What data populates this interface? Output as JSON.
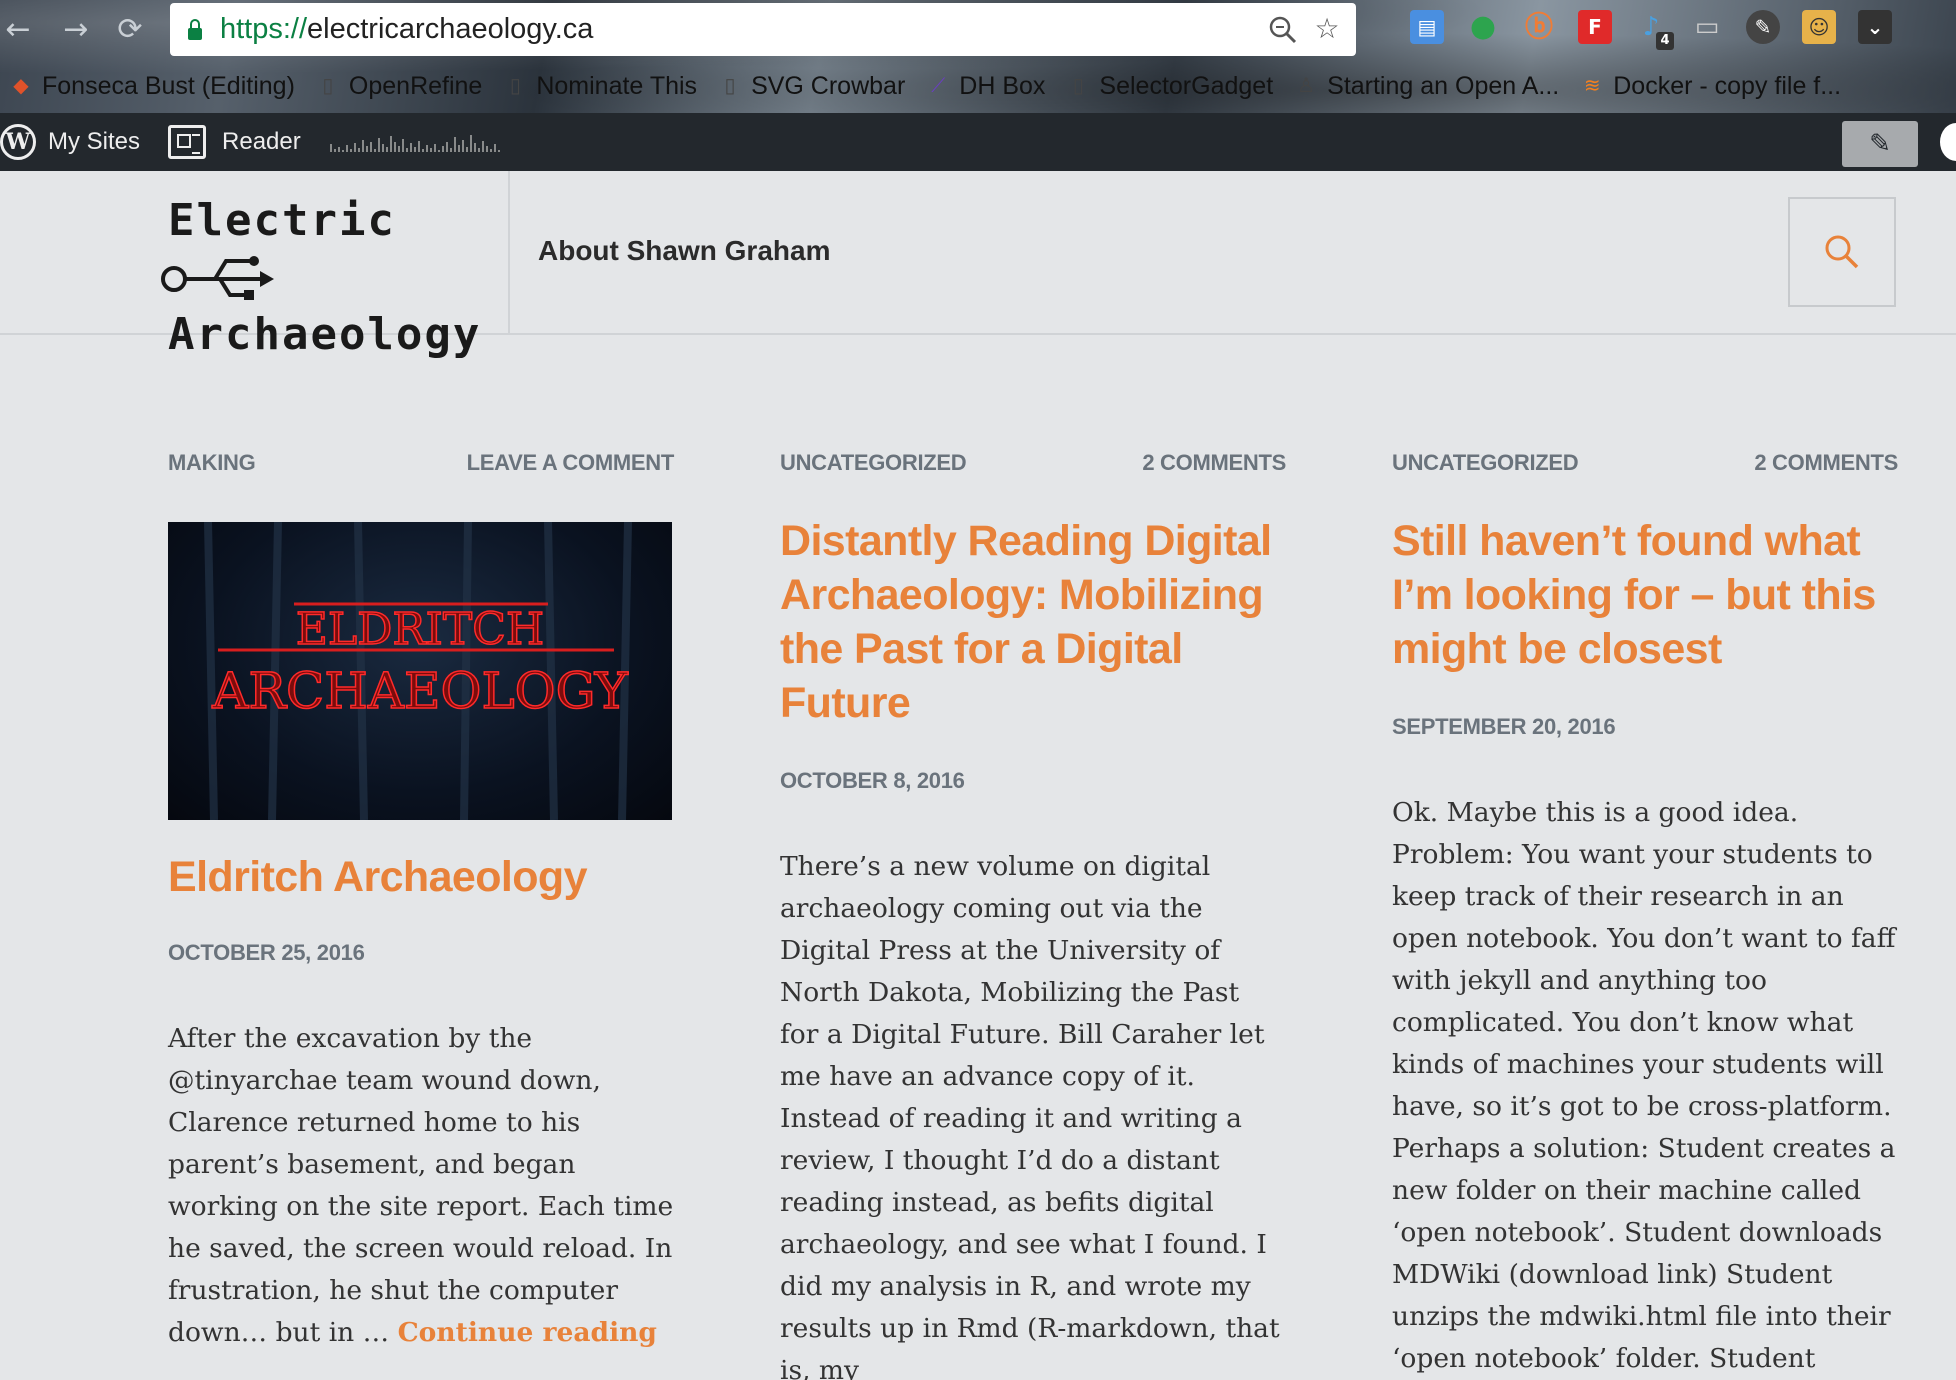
{
  "browser": {
    "url_scheme": "https://",
    "url_host": "electricarchaeology.ca",
    "bookmarks": [
      {
        "label": "Fonseca Bust (Editing)",
        "icon": "diamond-icon"
      },
      {
        "label": "OpenRefine",
        "icon": "page-icon"
      },
      {
        "label": "Nominate This",
        "icon": "page-icon"
      },
      {
        "label": "SVG Crowbar",
        "icon": "page-icon"
      },
      {
        "label": "DH Box",
        "icon": "wand-icon"
      },
      {
        "label": "SelectorGadget",
        "icon": "page-icon"
      },
      {
        "label": "Starting an Open A...",
        "icon": "person-icon"
      },
      {
        "label": "Docker - copy file f...",
        "icon": "stack-icon"
      }
    ],
    "extension_badge": "4"
  },
  "adminbar": {
    "my_sites": "My Sites",
    "reader": "Reader"
  },
  "header": {
    "logo_line1": "Electric",
    "logo_line2": "Archaeology",
    "nav_about": "About Shawn Graham"
  },
  "posts": [
    {
      "category": "MAKING",
      "comments": "LEAVE A COMMENT",
      "thumb_line1": "ELDRITCH",
      "thumb_line2": "ARCHAEOLOGY",
      "title": "Eldritch Archaeology",
      "date": "OCTOBER 25, 2016",
      "excerpt": "After the excavation by the @tinyarchae team wound down, Clarence returned home to his parent’s basement, and began working on the site report. Each time he saved, the screen would reload. In frustration, he shut the computer down… but in … ",
      "continue": "Continue reading"
    },
    {
      "category": "UNCATEGORIZED",
      "comments": "2 COMMENTS",
      "title": "Distantly Reading Digital Archaeology: Mobilizing the Past for a Digital Future",
      "date": "OCTOBER 8, 2016",
      "excerpt": "There’s a new volume on digital archaeology coming out via the Digital Press at the University of North Dakota, Mobilizing the Past for a Digital Future. Bill Caraher let me have an advance copy of it. Instead of reading it and writing a review, I thought I’d do a distant reading instead, as befits digital archaeology, and see what I found. I did my analysis in R, and wrote my results up in Rmd (R-markdown, that is, my"
    },
    {
      "category": "UNCATEGORIZED",
      "comments": "2 COMMENTS",
      "title": "Still haven’t found what I’m looking for – but this might be closest",
      "date": "SEPTEMBER 20, 2016",
      "excerpt": "Ok. Maybe this is a good idea. Problem: You want your students to keep track of their research in an open notebook. You don’t want to faff with jekyll and anything too complicated. You don’t know what kinds of machines your students will have, so it’s got to be cross-platform. Perhaps a solution: Student creates a new folder on their machine called ‘open notebook’. Student downloads MDWiki (download link) Student unzips the mdwiki.html file into their ‘open notebook’ folder. Student"
    }
  ],
  "colors": {
    "accent": "#e8823a",
    "meta": "#6a737c",
    "adminbar": "#23282d",
    "page_bg": "#e4e6e8"
  }
}
